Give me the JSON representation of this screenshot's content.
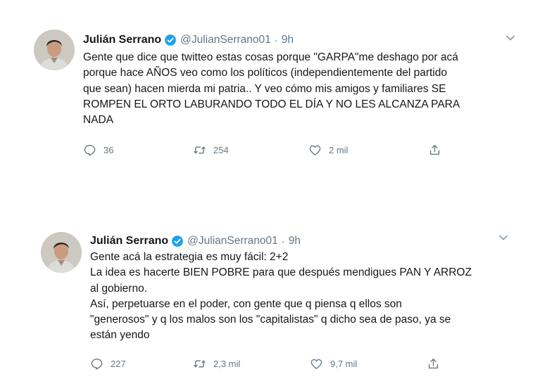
{
  "tweets": [
    {
      "name": "Julián Serrano",
      "handle": "@JulianSerrano01",
      "separator": "·",
      "time": "9h",
      "text": "Gente que dice que twitteo estas cosas porque \"GARPA\"me deshago por acá\nporque hace AÑOS veo como los políticos (independientemente del partido\nque sean) hacen mierda mi patria.. Y veo cómo mis amigos y familiares SE\nROMPEN EL ORTO LABURANDO TODO EL DÍA Y NO LES ALCANZA PARA\nNADA",
      "replies": "36",
      "retweets": "254",
      "likes": "2 mil"
    },
    {
      "name": "Julián Serrano",
      "handle": "@JulianSerrano01",
      "separator": "·",
      "time": "9h",
      "text": "Gente acá la estrategia es muy fácil: 2+2\nLa idea es hacerte BIEN POBRE para que después mendigues PAN Y ARROZ\nal gobierno.\nAsí, perpetuarse en el poder, con gente que  q piensa q ellos son\n\"generosos\" y q los malos son los \"capitalistas\" q dicho sea de paso, ya se\nestán yendo",
      "replies": "227",
      "retweets": "2,3 mil",
      "likes": "9,7 mil"
    }
  ],
  "icons": {
    "verified": "verified-badge-icon",
    "more": "chevron-down-icon",
    "reply": "reply-icon",
    "retweet": "retweet-icon",
    "like": "heart-icon",
    "share": "share-icon"
  },
  "colors": {
    "verified": "#1da1f2",
    "muted": "#657786",
    "text": "#14171a"
  }
}
